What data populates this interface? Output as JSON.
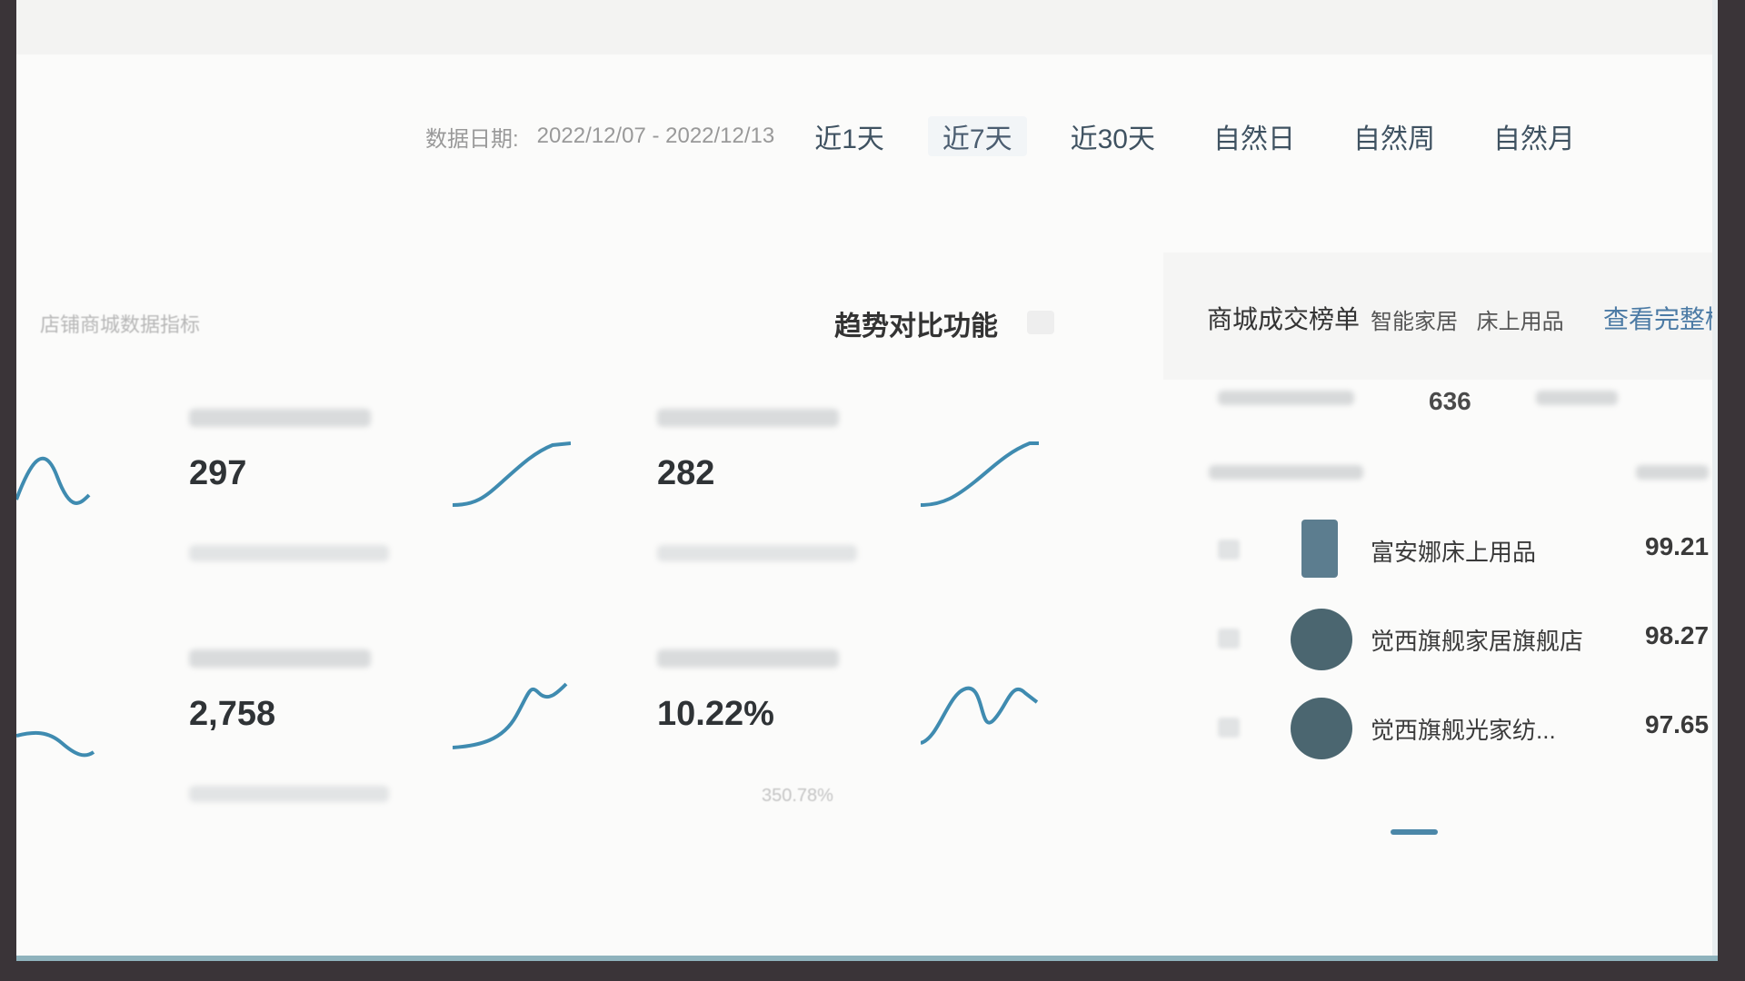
{
  "colors": {
    "accent": "#4b87a8",
    "sparkline": "#3f8bb0",
    "link": "#4c7ba5"
  },
  "filter": {
    "date_label": "数据日期:",
    "date_range": "2022/12/07 - 2022/12/13",
    "tabs": [
      "近1天",
      "近7天",
      "近30天",
      "自然日",
      "自然周",
      "自然月"
    ],
    "active_tab": "近7天"
  },
  "overview": {
    "title": "店铺商城数据指标",
    "trend_link": "趋势对比功能",
    "metrics": [
      {
        "value": "297",
        "icon": "sparkline-up"
      },
      {
        "value": "282",
        "icon": "sparkline-up"
      },
      {
        "value": "2,758",
        "icon": "sparkline-rise"
      },
      {
        "value": "10.22%",
        "icon": "sparkline-wave",
        "footer": "350.78%"
      }
    ]
  },
  "ranking": {
    "title": "商城成交榜单",
    "tags": [
      "智能家居",
      "床上用品"
    ],
    "view_all": "查看完整榜单",
    "stat": "636",
    "rows": [
      {
        "name": "富安娜床上用品",
        "score": "99.21"
      },
      {
        "name": "觉西旗舰家居旗舰店",
        "score": "98.27"
      },
      {
        "name": "觉西旗舰光家纺...",
        "score": "97.65"
      }
    ]
  }
}
